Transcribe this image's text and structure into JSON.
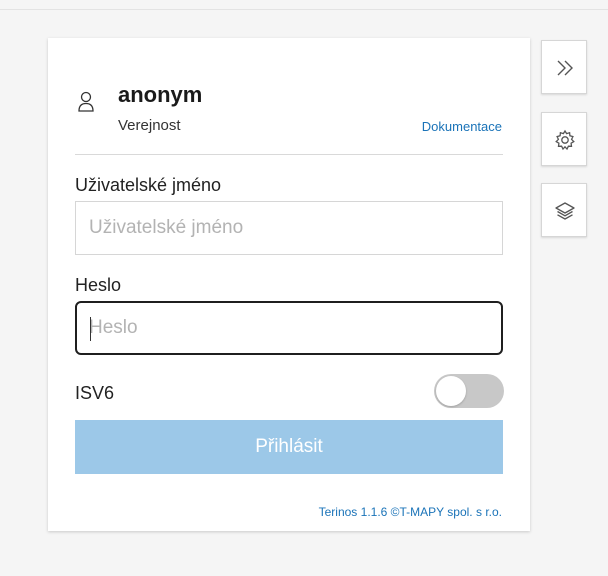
{
  "user": {
    "name": "anonym",
    "role": "Verejnost",
    "documentation_link": "Dokumentace"
  },
  "login_form": {
    "username": {
      "label": "Uživatelské jméno",
      "placeholder": "Uživatelské jméno",
      "value": ""
    },
    "password": {
      "label": "Heslo",
      "placeholder": "Heslo",
      "value": ""
    },
    "isv6": {
      "label": "ISV6",
      "enabled": false
    },
    "submit_label": "Přihlásit"
  },
  "footer": {
    "text": "Terinos 1.1.6 ©T-MAPY spol. s r.o."
  },
  "side_toolbar": [
    {
      "icon": "double-chevron-right-icon"
    },
    {
      "icon": "gear-icon"
    },
    {
      "icon": "layers-icon"
    }
  ],
  "colors": {
    "link": "#1a73b8",
    "button_bg": "#9cc8e8",
    "toggle_off": "#c8c8c8",
    "page_bg": "#f5f5f5"
  }
}
